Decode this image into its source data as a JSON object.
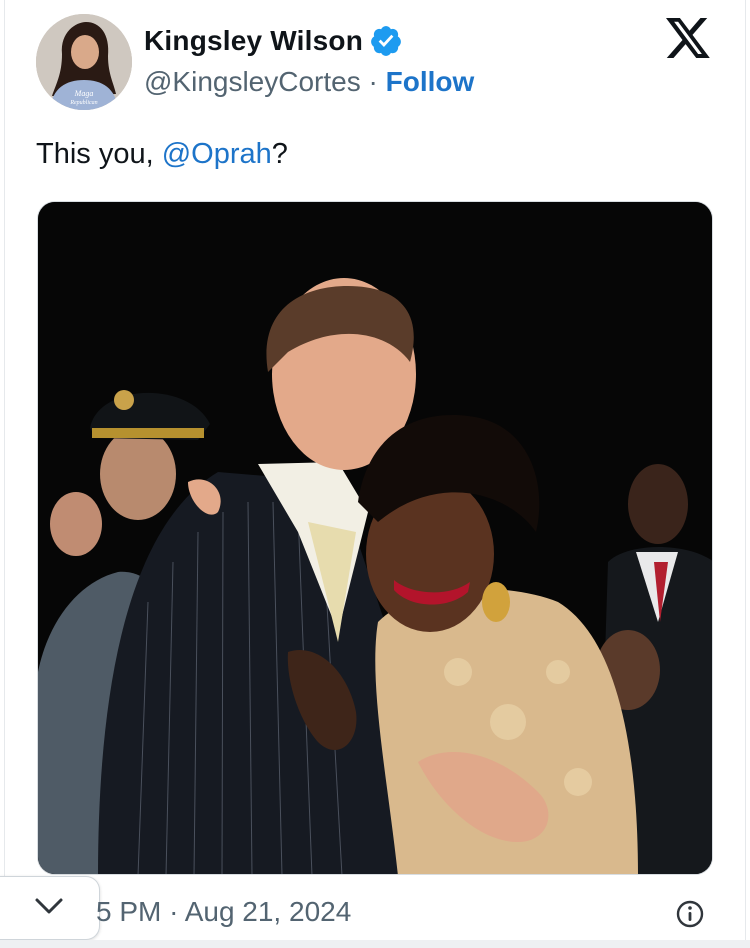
{
  "author": {
    "name": "Kingsley Wilson",
    "handle": "@KingsleyCortes",
    "separator": "·",
    "follow_label": "Follow",
    "avatar_shirt_text": "Maga\nRepublican"
  },
  "tweet": {
    "text_before": "This you, ",
    "mention": "@Oprah",
    "text_after": "?"
  },
  "meta": {
    "timestamp": "5 PM · Aug 21, 2024"
  },
  "icons": {
    "verified": "verified-badge-icon",
    "brand": "x-logo-icon",
    "info": "info-icon",
    "collapse": "chevron-down-icon"
  },
  "colors": {
    "link": "#1d74c9",
    "verified": "#1d9bf0",
    "muted": "#536471"
  }
}
